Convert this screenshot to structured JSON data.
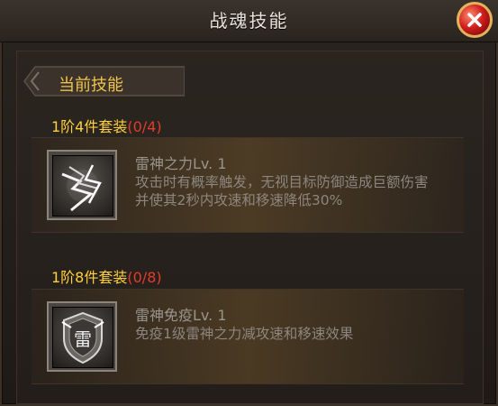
{
  "window": {
    "title": "战魂技能",
    "close_icon": "close-x-icon"
  },
  "section": {
    "label": "当前技能"
  },
  "sets": [
    {
      "title_prefix": "1阶4件套装",
      "progress": "(0/4)",
      "skill": {
        "icon": "thunder-god-power-icon",
        "name": "雷神之力Lv. 1",
        "description": "攻击时有概率触发，无视目标防御造成巨额伤害并使其2秒内攻速和移速降低30%"
      }
    },
    {
      "title_prefix": "1阶8件套装",
      "progress": "(0/8)",
      "skill": {
        "icon": "thunder-immunity-shield-icon",
        "name": "雷神免疫Lv. 1",
        "description": "免疫1级雷神之力减攻速和移速效果",
        "icon_glyph": "雷"
      }
    }
  ],
  "colors": {
    "gold": "#ffcf3c",
    "red": "#e23c2b",
    "section_label": "#f0c44a"
  }
}
